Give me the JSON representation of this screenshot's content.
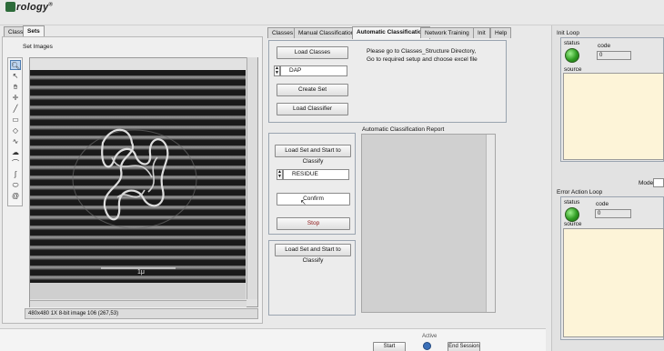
{
  "app": {
    "logo_text": "rology",
    "logo_mark": "®"
  },
  "left_tabs": [
    "Class",
    "Sets"
  ],
  "set_images_label": "Set Images",
  "tools": [
    "zoom-icon",
    "pointer-icon",
    "hand-icon",
    "crosshair-icon",
    "line-icon",
    "rectangle-icon",
    "diamond-icon",
    "polyline-icon",
    "freehand-shape-icon",
    "arc-icon",
    "freehand-line-icon",
    "ellipse-icon",
    "spiral-icon"
  ],
  "image": {
    "scale_label": "1μ",
    "status": "480x480 1X 8-bit image 106   (267,53)"
  },
  "main_tabs": [
    "Classes",
    "Manual Classification",
    "Automatic Classification",
    "Network Training",
    "Init",
    "Help"
  ],
  "classes_frame": {
    "load_classes": "Load Classes",
    "class_select": "DAP",
    "create_set": "Create Set",
    "load_classifier": "Load Classifier",
    "instructions": "Please go to Classes_Structure Directory,\nGo to required setup and choose excel file"
  },
  "classify_frame": {
    "load_set_classify": "Load Set and Start to Classify",
    "result_select": "RESIDUE",
    "confirm": "Confirm",
    "stop": "Stop"
  },
  "second_frame": {
    "load_set_classify": "Load Set and Start to Classify"
  },
  "report_label": "Automatic Classification Report",
  "init_loop": {
    "title": "Init Loop",
    "status_label": "status",
    "code_label": "code",
    "code_value": "0",
    "source_label": "source"
  },
  "mode_label": "Mode",
  "error_loop": {
    "title": "Error Action Loop",
    "status_label": "status",
    "code_label": "code",
    "code_value": "0",
    "source_label": "source"
  },
  "bottom": {
    "active_label": "Active",
    "start_session": "Start Session",
    "end_session": "End Session"
  }
}
